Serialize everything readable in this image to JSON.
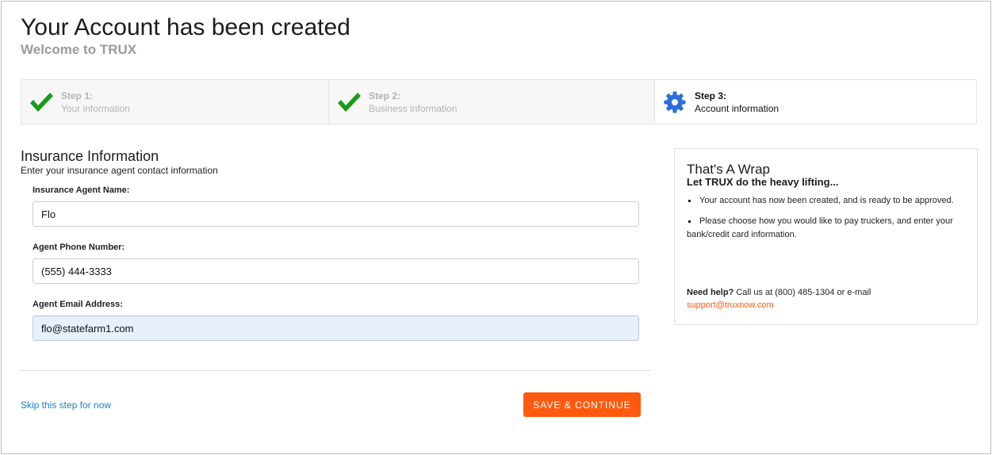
{
  "header": {
    "title": "Your Account has been created",
    "subtitle": "Welcome to TRUX"
  },
  "steps": [
    {
      "number": "Step 1:",
      "label": "Your information",
      "status": "complete",
      "icon": "checkmark-icon"
    },
    {
      "number": "Step 2:",
      "label": "Business information",
      "status": "complete",
      "icon": "checkmark-icon"
    },
    {
      "number": "Step 3:",
      "label": "Account information",
      "status": "current",
      "icon": "gear-icon"
    }
  ],
  "form": {
    "title": "Insurance Information",
    "subtitle": "Enter your insurance agent contact information",
    "fields": [
      {
        "label": "Insurance Agent Name:",
        "value": "Flo"
      },
      {
        "label": "Agent Phone Number:",
        "value": "(555) 444-3333"
      },
      {
        "label": "Agent Email Address:",
        "value": "flo@statefarm1.com"
      }
    ],
    "skip_label": "Skip this step for now",
    "save_label": "SAVE & CONTINUE"
  },
  "sidebar": {
    "title": "That's A Wrap",
    "subtitle": "Let TRUX do the heavy lifting...",
    "bullets": [
      "Your account has now been created, and is ready to be approved.",
      "Please choose how you would like to pay truckers, and enter your bank/credit card information."
    ],
    "help_label": "Need help?",
    "help_text": "Call us at (800) 485-1304 or e-mail",
    "help_email": "support@truxnow.com"
  },
  "colors": {
    "accent": "#ff5a0f",
    "link": "#1b7fc0",
    "check": "#1a9a1a",
    "gear": "#2b6fd6"
  }
}
